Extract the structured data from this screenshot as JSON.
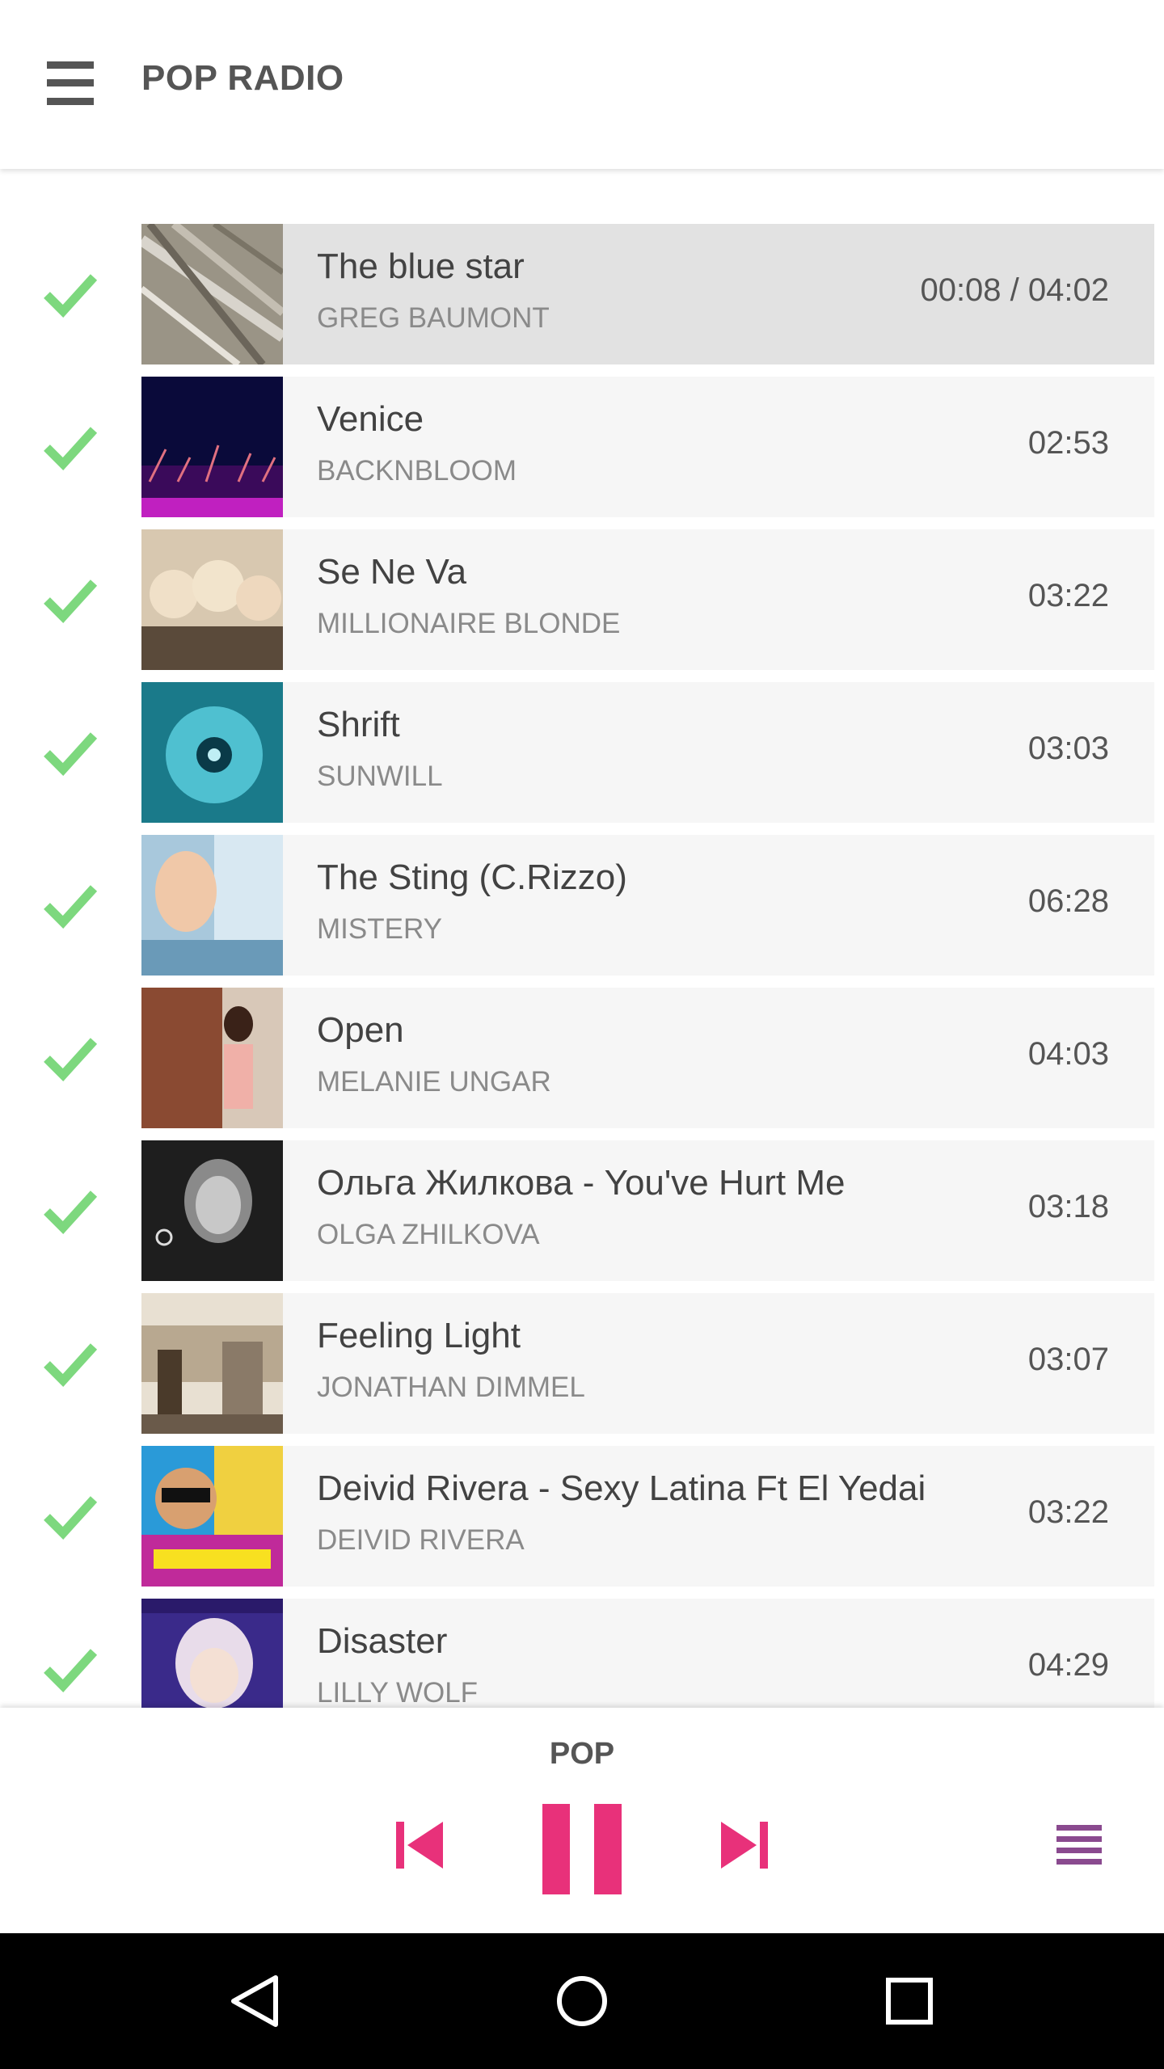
{
  "app": {
    "title": "POP RADIO",
    "menu_icon": "hamburger-menu-icon"
  },
  "tracks": [
    {
      "title": "The blue star",
      "artist": "GREG BAUMONT",
      "time": "00:08 / 04:02",
      "current": true
    },
    {
      "title": "Venice",
      "artist": "BACKNBLOOM",
      "time": "02:53"
    },
    {
      "title": "Se Ne Va",
      "artist": "MILLIONAIRE BLONDE",
      "time": "03:22"
    },
    {
      "title": "Shrift",
      "artist": "SUNWILL",
      "time": "03:03"
    },
    {
      "title": "The Sting (C.Rizzo)",
      "artist": "MISTERY",
      "time": "06:28"
    },
    {
      "title": "Open",
      "artist": "MELANIE UNGAR",
      "time": "04:03"
    },
    {
      "title": "Ольга Жилкова - You've Hurt Me",
      "artist": "OLGA ZHILKOVA",
      "time": "03:18"
    },
    {
      "title": "Feeling Light",
      "artist": "JONATHAN DIMMEL",
      "time": "03:07"
    },
    {
      "title": "Deivid Rivera - Sexy Latina Ft El Yedai",
      "artist": "DEIVID RIVERA",
      "time": "03:22"
    },
    {
      "title": "Disaster",
      "artist": "LILLY WOLF",
      "time": "04:29"
    }
  ],
  "player": {
    "station": "POP",
    "controls": [
      "skip-previous-icon",
      "pause-icon",
      "skip-next-icon",
      "queue-list-icon"
    ]
  },
  "colors": {
    "accent": "#e8317a",
    "check": "#7dd87e",
    "queue_icon": "#8a4a8f",
    "title_text": "#555555",
    "current_row": "#e2e2e2",
    "row": "#f6f6f6",
    "navbar": "#000000"
  }
}
